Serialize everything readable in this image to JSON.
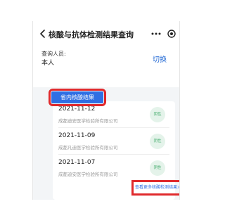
{
  "header": {
    "title": "核酸与抗体检测结果查询"
  },
  "query": {
    "label": "查询人员:",
    "name": "本人",
    "switch_label": "切换"
  },
  "tab": {
    "label": "省内核酸结果"
  },
  "results": [
    {
      "date": "2021-11-12",
      "lab": "成都迪安医学检验所有限公司",
      "status": "阴性"
    },
    {
      "date": "2021-11-09",
      "lab": "成都凡迪医学检验所有限公司",
      "status": "阴性"
    },
    {
      "date": "2021-11-07",
      "lab": "成都迪安医学检验所有限公司",
      "status": "阴性"
    }
  ],
  "view_more_label": "查看更多核酸检测结果>>",
  "colors": {
    "accent": "#2f6fe4",
    "highlight_box": "#e0292c",
    "status_text": "#4caf73",
    "status_bg": "#e4f3ea"
  },
  "icons": [
    "back-arrow-icon",
    "more-dots-icon",
    "close-circle-icon"
  ]
}
